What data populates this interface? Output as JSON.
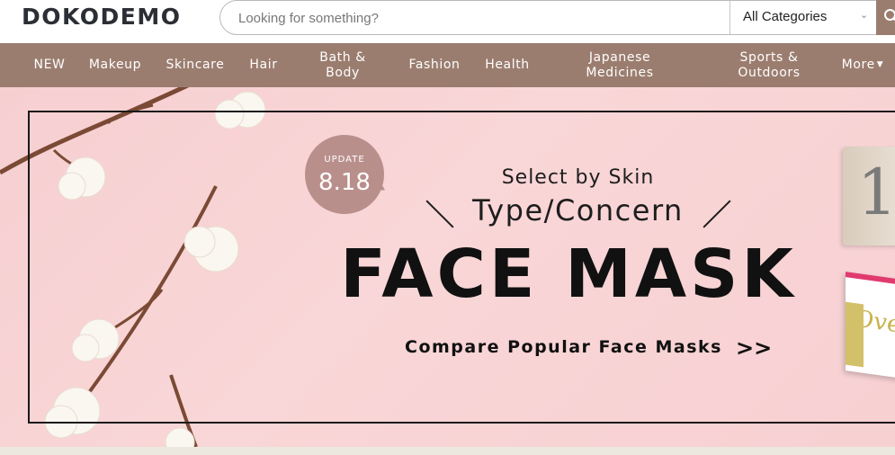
{
  "header": {
    "logo": "DOKODEMO",
    "search_placeholder": "Looking for something?",
    "category_selected": "All Categories"
  },
  "nav": {
    "items": [
      {
        "label": "NEW"
      },
      {
        "label": "Makeup"
      },
      {
        "label": "Skincare"
      },
      {
        "label": "Hair"
      },
      {
        "label": "Bath &\nBody"
      },
      {
        "label": "Fashion"
      },
      {
        "label": "Health"
      },
      {
        "label": "Japanese\nMedicines"
      },
      {
        "label": "Sports &\nOutdoors"
      },
      {
        "label": "More"
      }
    ]
  },
  "banner": {
    "badge_top": "UPDATE",
    "badge_date": "8.18",
    "subtitle_1": "Select by Skin",
    "subtitle_2": "Type/Concern",
    "title": "FACE MASK",
    "cta": "Compare Popular Face Masks",
    "cta_arrow": ">>",
    "product_numeral": "1",
    "product_text": "Ove"
  },
  "colors": {
    "nav_bg": "#9b7d6f",
    "banner_bg": "#f8d3d4",
    "badge": "#b98f8c"
  }
}
